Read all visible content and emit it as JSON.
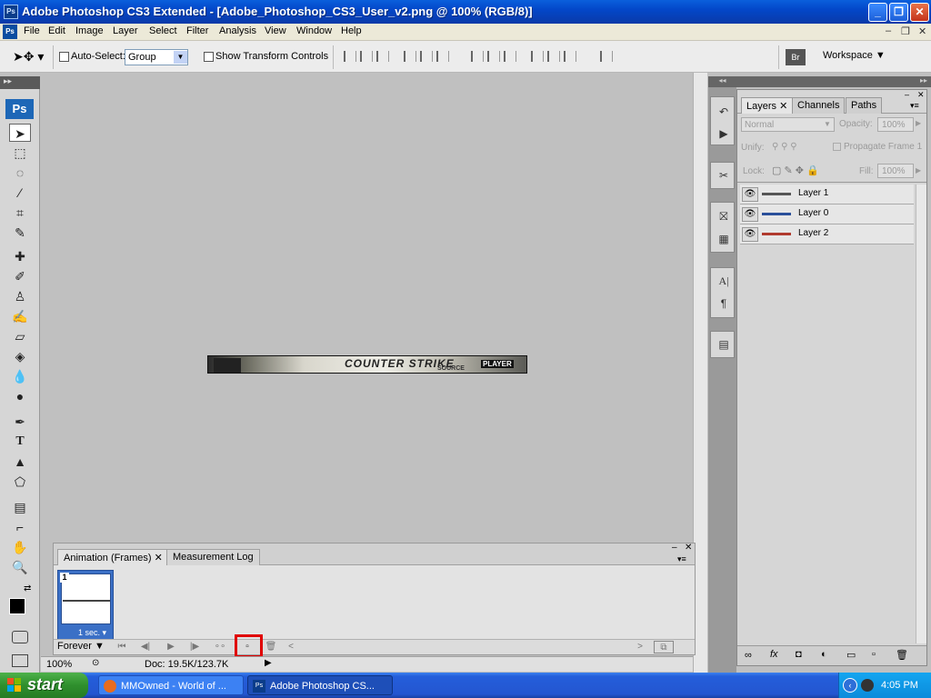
{
  "titlebar": {
    "app_icon": "Ps",
    "title": "Adobe Photoshop CS3 Extended - [Adobe_Photoshop_CS3_User_v2.png @ 100% (RGB/8)]"
  },
  "menubar": {
    "items": [
      "File",
      "Edit",
      "Image",
      "Layer",
      "Select",
      "Filter",
      "Analysis",
      "View",
      "Window",
      "Help"
    ]
  },
  "options": {
    "auto_select_label": "Auto-Select:",
    "auto_select_value": "Group",
    "transform_label": "Show Transform Controls",
    "workspace_label": "Workspace"
  },
  "toolbox": {
    "logo": "Ps"
  },
  "canvas": {
    "banner_title": "COUNTER STRIKE",
    "banner_sub": "SOURCE",
    "banner_badge": "PLAYER"
  },
  "animation": {
    "tabs": [
      "Animation (Frames)",
      "Measurement Log"
    ],
    "frame_number": "1",
    "frame_delay": "1 sec.",
    "loop": "Forever"
  },
  "status": {
    "zoom": "100%",
    "doc": "Doc: 19.5K/123.7K"
  },
  "layers_panel": {
    "tabs": [
      "Layers",
      "Channels",
      "Paths"
    ],
    "blend_mode": "Normal",
    "opacity_label": "Opacity:",
    "opacity_value": "100%",
    "unify_label": "Unify:",
    "propagate_label": "Propagate Frame 1",
    "lock_label": "Lock:",
    "fill_label": "Fill:",
    "fill_value": "100%",
    "layers": [
      {
        "name": "Layer 1",
        "color": "#555555"
      },
      {
        "name": "Layer 0",
        "color": "#2a4f9a"
      },
      {
        "name": "Layer 2",
        "color": "#b03a2e"
      }
    ]
  },
  "taskbar": {
    "start": "start",
    "tasks": [
      "MMOwned - World of ...",
      "Adobe Photoshop CS..."
    ],
    "clock": "4:05 PM"
  }
}
